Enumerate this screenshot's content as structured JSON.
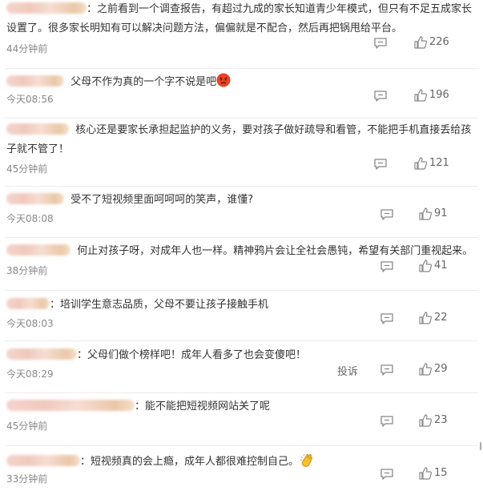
{
  "comments": [
    {
      "lines": [
        "之前看到一个调查报告，有超过九成的家长知道青少年模式，但只有不足五成家长",
        "设置了。很多家长明知有可以解决问题方法，偏偏就是不配合，然后再把锅甩给平台。"
      ],
      "time": "44分钟前",
      "likes": "226"
    },
    {
      "lines": [
        "父母不作为真的一个字不说是吧"
      ],
      "emoji": "angry",
      "time": "今天08:56",
      "likes": "196"
    },
    {
      "lines": [
        "核心还是要家长承担起监护的义务，要对孩子做好疏导和看管，不能把手机直接丢给孩",
        "子就不管了！"
      ],
      "time": "45分钟前",
      "likes": "121"
    },
    {
      "lines": [
        "受不了短视频里面呵呵呵的笑声，谁懂?"
      ],
      "time": "今天08:08",
      "likes": "91"
    },
    {
      "lines": [
        "何止对孩子呀，对成年人也一样。精神鸦片会让全社会愚钝，希望有关部门重视起来。"
      ],
      "time": "38分钟前",
      "likes": "41"
    },
    {
      "lines": [
        "培训学生意志品质，父母不要让孩子接触手机"
      ],
      "time": "今天08:03",
      "likes": "22"
    },
    {
      "lines": [
        "父母们做个榜样吧！成年人看多了也会变傻吧！"
      ],
      "time": "今天08:29",
      "likes": "29",
      "report": "投诉"
    },
    {
      "lines": [
        "能不能把短视频网站关了呢"
      ],
      "time": "45分钟前",
      "likes": "23"
    },
    {
      "lines": [
        "短视频真的会上瘾，成年人都很难控制自己。"
      ],
      "emoji": "clap",
      "time": "33分钟前",
      "likes": "15"
    }
  ],
  "icons": {
    "reply": "comment-icon",
    "like": "thumbs-up-icon"
  },
  "colors": {
    "text": "#333333",
    "meta": "#888888",
    "divider": "#ececec"
  }
}
